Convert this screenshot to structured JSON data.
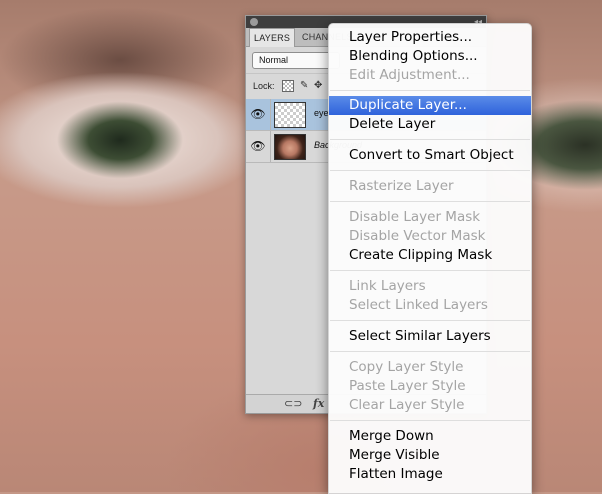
{
  "panel": {
    "tabs": [
      "LAYERS",
      "CHANNELS"
    ],
    "blend_mode": "Normal",
    "lock_label": "Lock:",
    "layers": [
      {
        "name": "eye",
        "selected": true,
        "visible": true
      },
      {
        "name": "Background",
        "selected": false,
        "visible": true
      }
    ],
    "icons": {
      "eye": "eye-icon",
      "link": "link-icon",
      "fx": "fx-icon"
    },
    "fx_label": "fx",
    "link_glyph": "⊂⊃",
    "eye_glyph": "👁"
  },
  "menu": {
    "items": [
      {
        "label": "Layer Properties...",
        "enabled": true
      },
      {
        "label": "Blending Options...",
        "enabled": true
      },
      {
        "label": "Edit Adjustment...",
        "enabled": false
      },
      {
        "label": "Duplicate Layer...",
        "enabled": true,
        "highlighted": true
      },
      {
        "label": "Delete Layer",
        "enabled": true
      },
      {
        "label": "Convert to Smart Object",
        "enabled": true
      },
      {
        "label": "Rasterize Layer",
        "enabled": false
      },
      {
        "label": "Disable Layer Mask",
        "enabled": false
      },
      {
        "label": "Disable Vector Mask",
        "enabled": false
      },
      {
        "label": "Create Clipping Mask",
        "enabled": true
      },
      {
        "label": "Link Layers",
        "enabled": false
      },
      {
        "label": "Select Linked Layers",
        "enabled": false
      },
      {
        "label": "Select Similar Layers",
        "enabled": true
      },
      {
        "label": "Copy Layer Style",
        "enabled": false
      },
      {
        "label": "Paste Layer Style",
        "enabled": false
      },
      {
        "label": "Clear Layer Style",
        "enabled": false
      },
      {
        "label": "Merge Down",
        "enabled": true
      },
      {
        "label": "Merge Visible",
        "enabled": true
      },
      {
        "label": "Flatten Image",
        "enabled": true
      }
    ]
  },
  "colors": {
    "highlight": "#2f63db",
    "disabled_text": "#a4a4a4",
    "selected_layer": "#a9c3dd"
  }
}
